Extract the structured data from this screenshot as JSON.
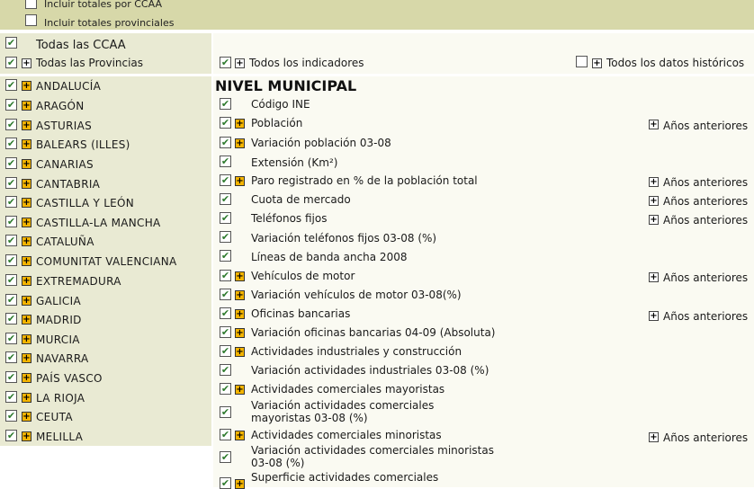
{
  "top_options": [
    "Incluir totales por CCAA",
    "Incluir totales provinciales"
  ],
  "left_header": {
    "all_ccaa": "Todas las CCAA",
    "all_provinces": "Todas las Provincias"
  },
  "right_header": {
    "all_indicators": "Todos los indicadores",
    "all_historical": "Todos los datos históricos"
  },
  "regions": [
    "ANDALUCÍA",
    "ARAGÓN",
    "ASTURIAS",
    "BALEARS (ILLES)",
    "CANARIAS",
    "CANTABRIA",
    "CASTILLA Y LEÓN",
    "CASTILLA-LA MANCHA",
    "CATALUÑA",
    "COMUNITAT VALENCIANA",
    "EXTREMADURA",
    "GALICIA",
    "MADRID",
    "MURCIA",
    "NAVARRA",
    "PAÍS VASCO",
    "LA RIOJA",
    "CEUTA",
    "MELILLA"
  ],
  "section_title": "NIVEL MUNICIPAL",
  "previous_years_label": "Años anteriores",
  "indicators": [
    {
      "label": "Código INE"
    },
    {
      "label": "Población"
    },
    {
      "label": "Variación población 03-08"
    },
    {
      "label": "Extensión (Km²)"
    },
    {
      "label": "Paro registrado en % de la población total"
    },
    {
      "label": "Cuota de mercado"
    },
    {
      "label": "Teléfonos fijos"
    },
    {
      "label": "Variación teléfonos fijos 03-08 (%)"
    },
    {
      "label": "Líneas de banda ancha 2008"
    },
    {
      "label": "Vehículos de motor"
    },
    {
      "label": "Variación vehículos de motor 03-08(%)"
    },
    {
      "label": "Oficinas bancarias"
    },
    {
      "label": "Variación oficinas bancarias 04-09 (Absoluta)"
    },
    {
      "label": "Actividades industriales y construcción"
    },
    {
      "label": "Variación actividades industriales 03-08 (%)"
    },
    {
      "label": "Actividades comerciales mayoristas"
    },
    {
      "label": "Variación actividades comerciales mayoristas 03-08 (%)"
    },
    {
      "label": "Actividades comerciales minoristas"
    },
    {
      "label": "Variación actividades comerciales minoristas 03-08 (%)"
    },
    {
      "label": "Superficie actividades comerciales"
    }
  ]
}
